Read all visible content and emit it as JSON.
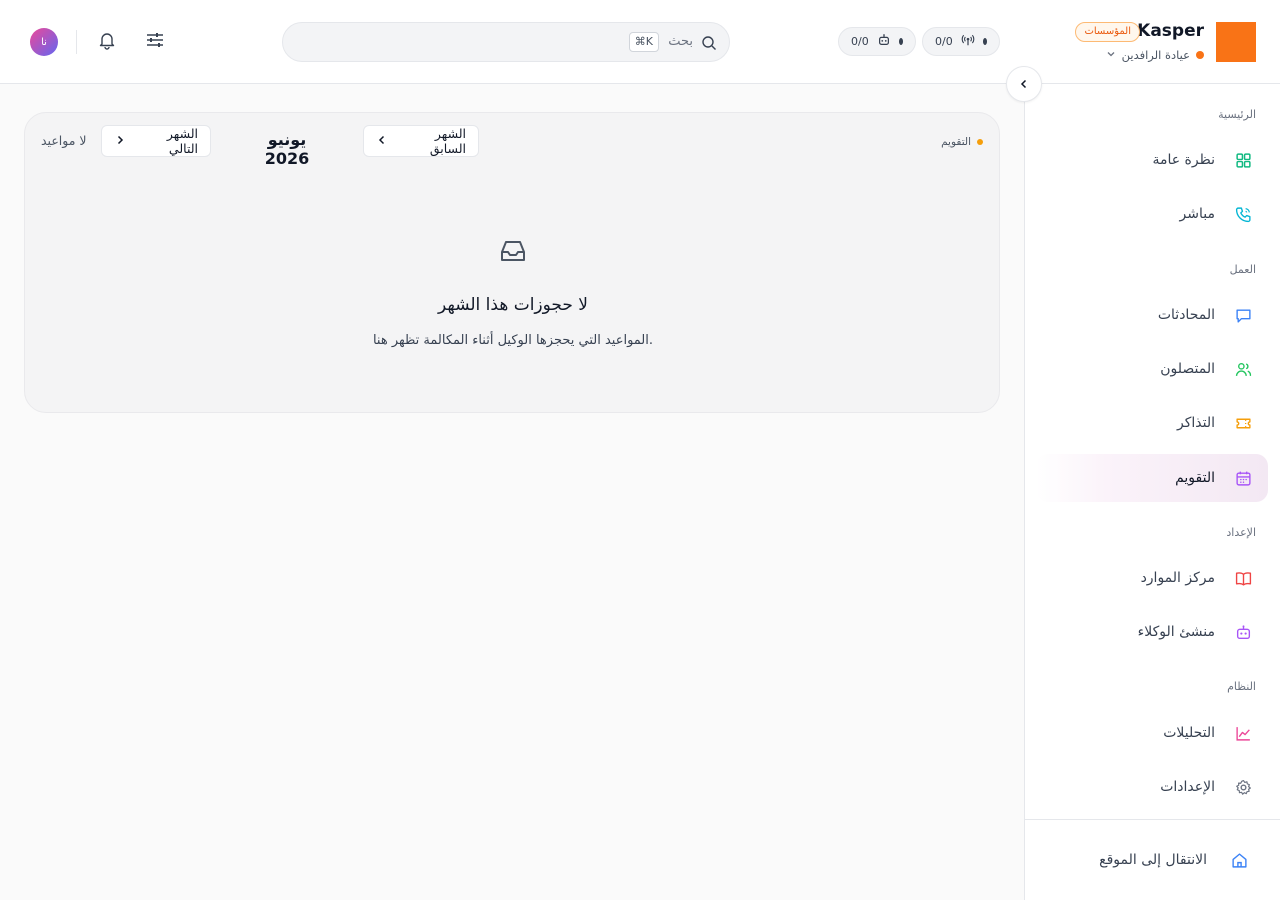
{
  "header": {
    "brand_name": "Kasper",
    "brand_badge": "المؤسسات",
    "org_name": "عيادة الرافدين",
    "stats": [
      {
        "value": "0/0",
        "icon": "antenna-icon"
      },
      {
        "value": "0/0",
        "icon": "robot-icon"
      }
    ],
    "search": {
      "placeholder": "بحث",
      "shortcut": "⌘K"
    },
    "avatar_initials": "نا"
  },
  "sidebar": {
    "sections": [
      {
        "label": "الرئيسية"
      },
      {
        "label": "العمل"
      },
      {
        "label": "الإعداد"
      },
      {
        "label": "النظام"
      }
    ],
    "items": [
      {
        "label": "نظرة عامة",
        "icon": "grid-icon",
        "color": "#10b981"
      },
      {
        "label": "مباشر",
        "icon": "phone-icon",
        "color": "#06b6d4"
      },
      {
        "label": "المحادثات",
        "icon": "chat-icon",
        "color": "#3b82f6"
      },
      {
        "label": "المتصلون",
        "icon": "users-icon",
        "color": "#22c55e"
      },
      {
        "label": "التذاكر",
        "icon": "ticket-icon",
        "color": "#f59e0b"
      },
      {
        "label": "التقويم",
        "icon": "calendar-icon",
        "color": "#a855f7",
        "active": true
      },
      {
        "label": "مركز الموارد",
        "icon": "book-icon",
        "color": "#ef4444"
      },
      {
        "label": "منشئ الوكلاء",
        "icon": "robot-icon",
        "color": "#a855f7"
      },
      {
        "label": "التحليلات",
        "icon": "chart-icon",
        "color": "#ec4899"
      },
      {
        "label": "الإعدادات",
        "icon": "gear-icon",
        "color": "#6b7280"
      }
    ],
    "goto_site": {
      "label": "الانتقال إلى الموقع",
      "icon": "home-icon",
      "color": "#3b82f6"
    }
  },
  "calendar": {
    "breadcrumb": "التقويم",
    "prev_label": "الشهر السابق",
    "next_label": "الشهر التالي",
    "month_title": "يونيو 2026",
    "appointments_status": "لا مواعيد",
    "empty_title": "لا حجوزات هذا الشهر",
    "empty_description": "المواعيد التي يحجزها الوكيل أثناء المكالمة تظهر هنا."
  },
  "colors": {
    "brand": "#f97316",
    "active_nav_bg": "#f3e8f3"
  }
}
